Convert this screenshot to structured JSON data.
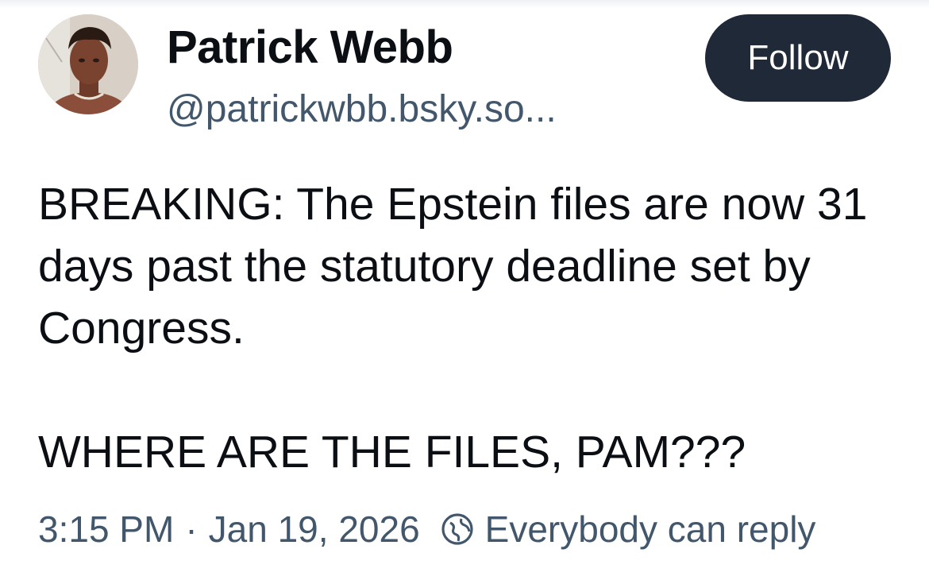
{
  "author": {
    "display_name": "Patrick Webb",
    "handle": "@patrickwbb.bsky.so...",
    "avatar_icon": "profile-photo"
  },
  "follow_button": {
    "label": "Follow"
  },
  "post": {
    "line1": "BREAKING: The Epstein files are now 31 days past the statutory deadline set by Congress.",
    "line2": "WHERE ARE THE FILES, PAM???"
  },
  "meta": {
    "time": "3:15 PM",
    "separator": "·",
    "date": "Jan 19, 2026",
    "reply_icon": "globe-reply-icon",
    "reply_setting": "Everybody can reply"
  },
  "colors": {
    "text": "#0b0f14",
    "muted": "#42576c",
    "button_bg": "#1f2937",
    "button_text": "#ffffff"
  }
}
